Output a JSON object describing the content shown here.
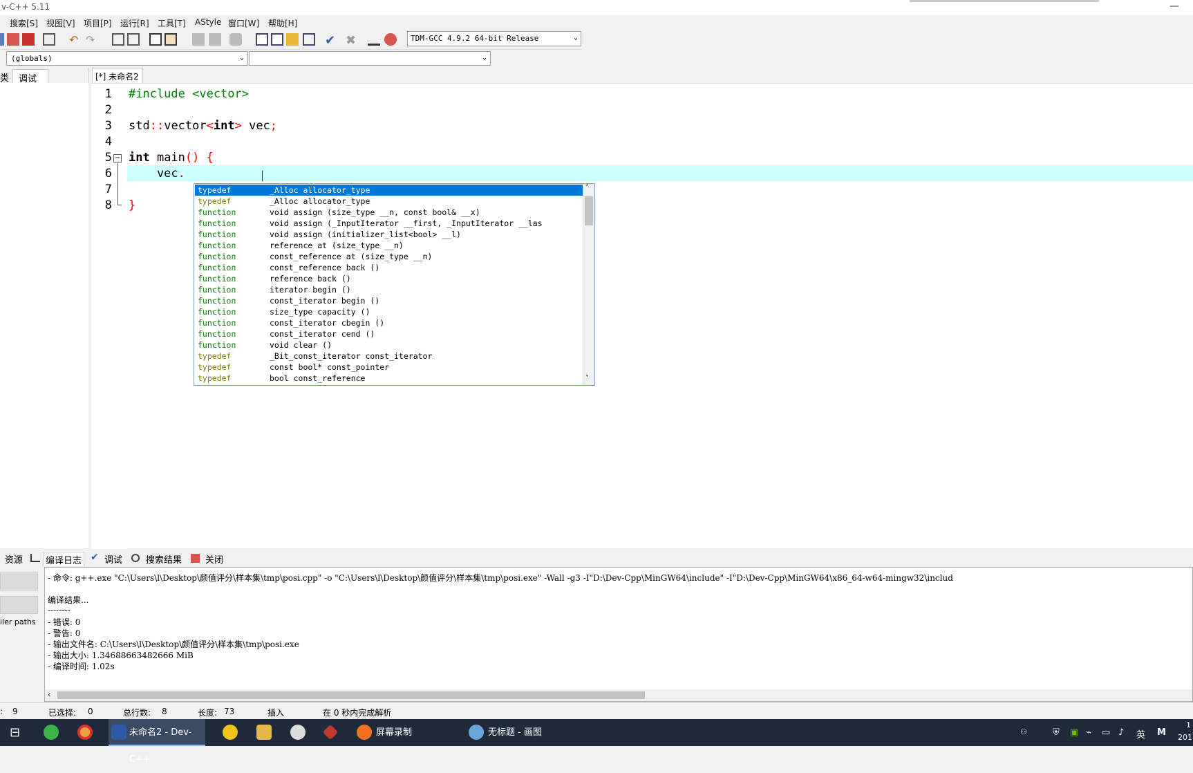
{
  "window": {
    "title": "v-C++ 5.11"
  },
  "menu": [
    "搜索[S]",
    "视图[V]",
    "项目[P]",
    "运行[R]",
    "工具[T]",
    "AStyle",
    "窗口[W]",
    "帮助[H]"
  ],
  "toolbar": {
    "compiler": "TDM-GCC 4.9.2 64-bit Release"
  },
  "scope": {
    "globals": "(globals)",
    "members": ""
  },
  "left_panel": {
    "tabs": [
      "类",
      "调试"
    ]
  },
  "editor": {
    "tab": "[*] 未命名2",
    "line_numbers": [
      "1",
      "2",
      "3",
      "4",
      "5",
      "6",
      "7",
      "8"
    ]
  },
  "autocomplete": [
    {
      "kind": "typedef",
      "sig": "_Alloc allocator_type"
    },
    {
      "kind": "typedef",
      "sig": "_Alloc allocator_type"
    },
    {
      "kind": "function",
      "sig": "void assign (size_type __n, const bool& __x)"
    },
    {
      "kind": "function",
      "sig": "void assign (_InputIterator __first, _InputIterator __las"
    },
    {
      "kind": "function",
      "sig": "void assign (initializer_list<bool> __l)"
    },
    {
      "kind": "function",
      "sig": "reference at (size_type __n)"
    },
    {
      "kind": "function",
      "sig": "const_reference at (size_type __n)"
    },
    {
      "kind": "function",
      "sig": "const_reference back ()"
    },
    {
      "kind": "function",
      "sig": "reference back ()"
    },
    {
      "kind": "function",
      "sig": "iterator begin ()"
    },
    {
      "kind": "function",
      "sig": "const_iterator begin ()"
    },
    {
      "kind": "function",
      "sig": "size_type capacity ()"
    },
    {
      "kind": "function",
      "sig": "const_iterator cbegin ()"
    },
    {
      "kind": "function",
      "sig": "const_iterator cend ()"
    },
    {
      "kind": "function",
      "sig": "void clear ()"
    },
    {
      "kind": "typedef",
      "sig": "_Bit_const_iterator const_iterator"
    },
    {
      "kind": "typedef",
      "sig": "const bool* const_pointer"
    },
    {
      "kind": "typedef",
      "sig": "bool const_reference"
    }
  ],
  "bottom_tabs": [
    "资源",
    "编译日志",
    "调试",
    "搜索结果",
    "关闭"
  ],
  "bottom_left": {
    "label": "iler paths"
  },
  "log": [
    "- 命令: g++.exe \"C:\\Users\\l\\Desktop\\颜值评分\\样本集\\tmp\\posi.cpp\" -o \"C:\\Users\\l\\Desktop\\颜值评分\\样本集\\tmp\\posi.exe\" -Wall -g3 -I\"D:\\Dev-Cpp\\MinGW64\\include\" -I\"D:\\Dev-Cpp\\MinGW64\\x86_64-w64-mingw32\\includ",
    "",
    "编译结果...",
    "--------",
    "- 错误: 0",
    "- 警告: 0",
    "- 输出文件名: C:\\Users\\l\\Desktop\\颜值评分\\样本集\\tmp\\posi.exe",
    "- 输出大小: 1.34688663482666 MiB",
    "- 编译时间: 1.02s"
  ],
  "status": {
    "row_label": ":",
    "row": "9",
    "selected_label": "已选择:",
    "selected": "0",
    "lines_label": "总行数:",
    "lines": "8",
    "length_label": "长度:",
    "length": "73",
    "mode": "插入",
    "parse": "在 0 秒内完成解析"
  },
  "taskbar": {
    "devcpp": "未命名2 - Dev-C++",
    "recorder": "屏幕录制",
    "paint": "无标题 - 画图",
    "ime": "英",
    "clock_top": "1",
    "clock_bottom": "201"
  },
  "colors": {
    "accent": "#0078d7",
    "current_line": "#ccffff",
    "taskbar": "#1f2a3b"
  }
}
